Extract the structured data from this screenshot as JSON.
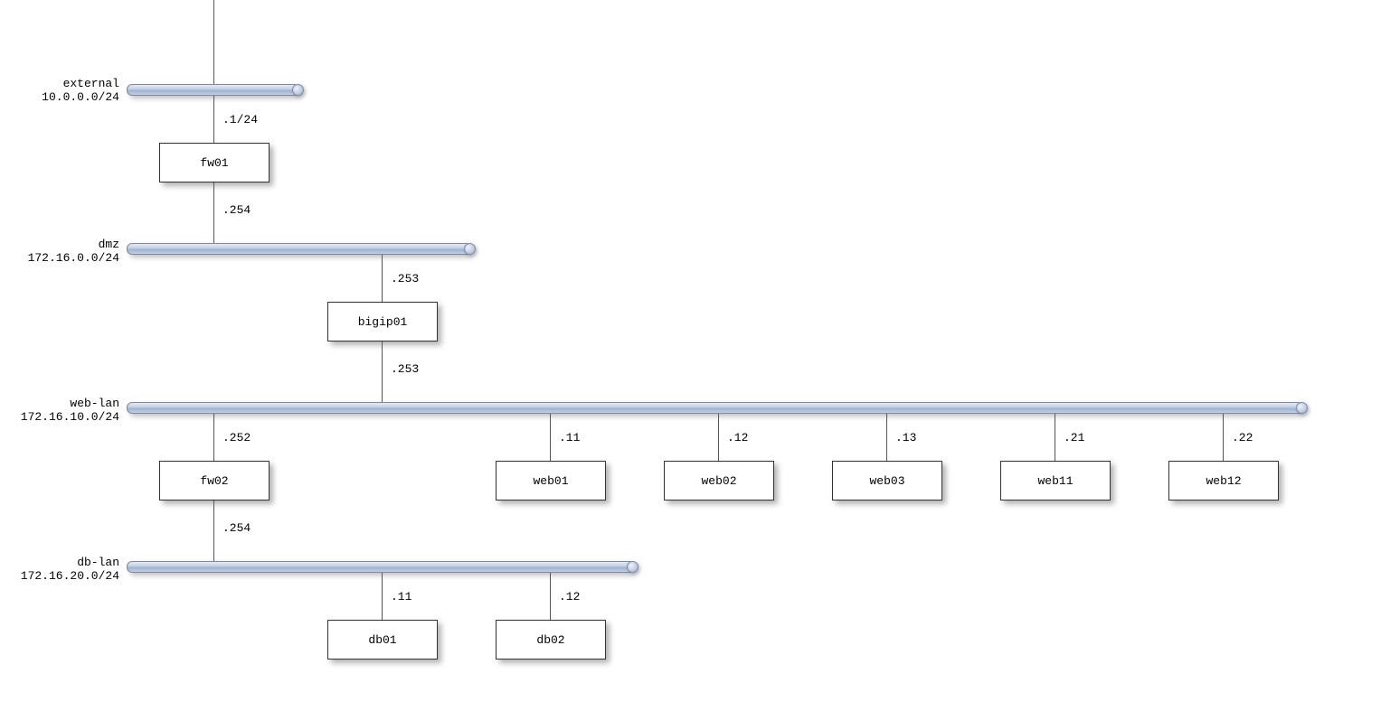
{
  "networks": {
    "external": {
      "name": "external",
      "cidr": "10.0.0.0/24"
    },
    "dmz": {
      "name": "dmz",
      "cidr": "172.16.0.0/24"
    },
    "weblan": {
      "name": "web-lan",
      "cidr": "172.16.10.0/24"
    },
    "dblan": {
      "name": "db-lan",
      "cidr": "172.16.20.0/24"
    }
  },
  "nodes": {
    "fw01": "fw01",
    "bigip01": "bigip01",
    "fw02": "fw02",
    "web01": "web01",
    "web02": "web02",
    "web03": "web03",
    "web11": "web11",
    "web12": "web12",
    "db01": "db01",
    "db02": "db02"
  },
  "ips": {
    "fw01_ext": ".1/24",
    "fw01_dmz": ".254",
    "bigip01_dmz": ".253",
    "bigip01_web": ".253",
    "fw02_web": ".252",
    "fw02_db": ".254",
    "web01": ".11",
    "web02": ".12",
    "web03": ".13",
    "web11": ".21",
    "web12": ".22",
    "db01": ".11",
    "db02": ".12"
  }
}
